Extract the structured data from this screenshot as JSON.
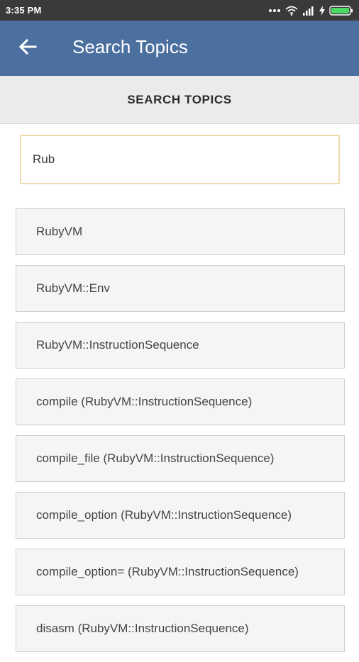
{
  "status_bar": {
    "time": "3:35 PM",
    "icons": [
      "more-dots-icon",
      "wifi-icon",
      "signal-icon",
      "charging-bolt-icon",
      "battery-icon"
    ]
  },
  "app_bar": {
    "back_icon": "arrow-back-icon",
    "title": "Search Topics",
    "color": "#4b70a0"
  },
  "sub_header": {
    "label": "SEARCH TOPICS"
  },
  "search": {
    "value": "Rub",
    "border_color": "#f0d9ae"
  },
  "results": [
    "RubyVM",
    "RubyVM::Env",
    "RubyVM::InstructionSequence",
    "compile (RubyVM::InstructionSequence)",
    "compile_file (RubyVM::InstructionSequence)",
    "compile_option (RubyVM::InstructionSequence)",
    "compile_option= (RubyVM::InstructionSequence)",
    "disasm (RubyVM::InstructionSequence)"
  ]
}
